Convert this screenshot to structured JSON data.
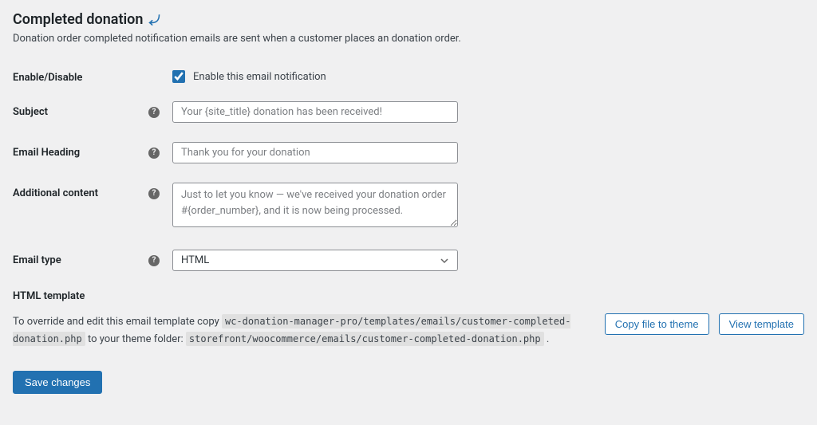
{
  "header": {
    "title": "Completed donation",
    "description": "Donation order completed notification emails are sent when a customer places an donation order."
  },
  "fields": {
    "enable": {
      "label": "Enable/Disable",
      "checkbox_label": "Enable this email notification",
      "checked": true
    },
    "subject": {
      "label": "Subject",
      "placeholder": "Your {site_title} donation has been received!",
      "value": ""
    },
    "heading": {
      "label": "Email Heading",
      "placeholder": "Thank you for your donation",
      "value": ""
    },
    "additional": {
      "label": "Additional content",
      "placeholder": "Just to let you know — we've received your donation order #{order_number}, and it is now being processed.",
      "value": ""
    },
    "type": {
      "label": "Email type",
      "selected": "HTML"
    }
  },
  "template": {
    "heading": "HTML template",
    "prefix": "To override and edit this email template copy ",
    "path1": "wc-donation-manager-pro/templates/emails/customer-completed-donation.php",
    "middle": " to your theme folder: ",
    "path2": "storefront/woocommerce/emails/customer-completed-donation.php",
    "suffix": " .",
    "copy_btn": "Copy file to theme",
    "view_btn": "View template"
  },
  "actions": {
    "save": "Save changes"
  }
}
